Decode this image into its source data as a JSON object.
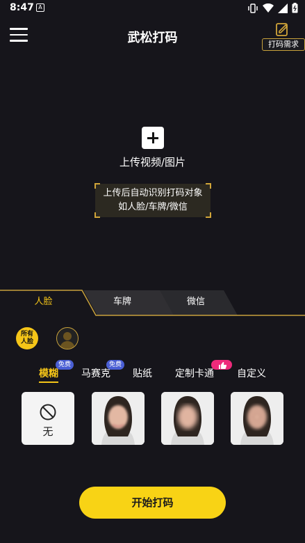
{
  "status_bar": {
    "time": "8:47",
    "notification_icon": "A"
  },
  "header": {
    "title": "武松打码",
    "demand_label": "打码需求"
  },
  "upload": {
    "label": "上传视频/图片"
  },
  "hint": {
    "line1": "上传后自动识别打码对象",
    "line2": "如人脸/车牌/微信"
  },
  "tabs": [
    {
      "label": "人脸",
      "active": true
    },
    {
      "label": "车牌",
      "active": false
    },
    {
      "label": "微信",
      "active": false
    }
  ],
  "face_selector": {
    "all_faces_label": "所有\n人脸"
  },
  "effects": [
    {
      "label": "模糊",
      "badge": "免费",
      "active": true
    },
    {
      "label": "马赛克",
      "badge": "免费",
      "active": false
    },
    {
      "label": "贴纸",
      "badge": "",
      "active": false
    },
    {
      "label": "定制卡通",
      "badge": "like",
      "active": false
    },
    {
      "label": "自定义",
      "badge": "",
      "active": false
    }
  ],
  "presets": {
    "none_label": "无"
  },
  "start_button": "开始打码",
  "colors": {
    "background": "#16151b",
    "accent": "#f5c518",
    "button": "#f8d315",
    "badge_free": "#4a5fd4",
    "badge_like": "#ee2a7b"
  }
}
